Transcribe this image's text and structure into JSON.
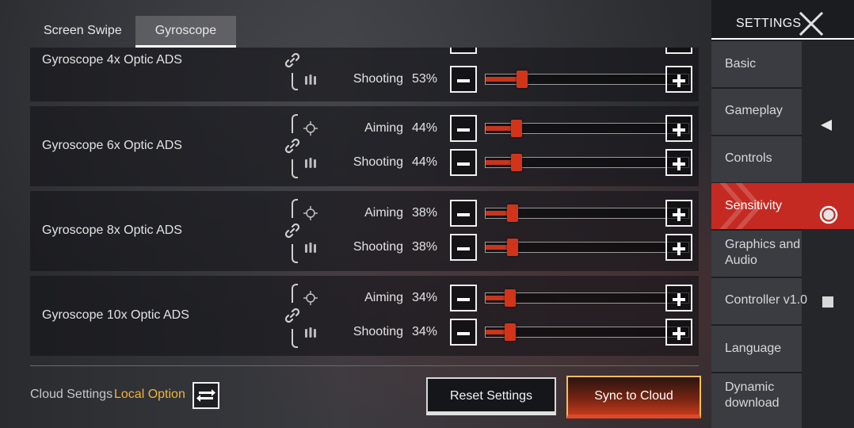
{
  "tabs": [
    {
      "label": "Screen Swipe",
      "active": false
    },
    {
      "label": "Gyroscope",
      "active": true
    }
  ],
  "groups": [
    {
      "label": "Gyroscope 4x Optic ADS",
      "rows": [
        {
          "label": "Shooting",
          "value_text": "53%",
          "value": 53
        }
      ]
    },
    {
      "label": "Gyroscope 6x Optic ADS",
      "rows": [
        {
          "label": "Aiming",
          "value_text": "44%",
          "value": 44
        },
        {
          "label": "Shooting",
          "value_text": "44%",
          "value": 44
        }
      ]
    },
    {
      "label": "Gyroscope 8x Optic ADS",
      "rows": [
        {
          "label": "Aiming",
          "value_text": "38%",
          "value": 38
        },
        {
          "label": "Shooting",
          "value_text": "38%",
          "value": 38
        }
      ]
    },
    {
      "label": "Gyroscope 10x Optic ADS",
      "rows": [
        {
          "label": "Aiming",
          "value_text": "34%",
          "value": 34
        },
        {
          "label": "Shooting",
          "value_text": "34%",
          "value": 34
        }
      ]
    }
  ],
  "bottom": {
    "cloud_label": "Cloud Settings",
    "local_label": "Local Option",
    "reset_label": "Reset Settings",
    "sync_label": "Sync to Cloud"
  },
  "sidebar": {
    "title": "SETTINGS",
    "items": [
      {
        "label": "Basic"
      },
      {
        "label": "Gameplay"
      },
      {
        "label": "Controls"
      },
      {
        "label": "Sensitivity",
        "active": true
      },
      {
        "label": "Graphics and Audio"
      },
      {
        "label": "Controller v1.0"
      },
      {
        "label": "Language"
      },
      {
        "label": "Dynamic download"
      }
    ]
  },
  "colors": {
    "accent_red": "#c42a22",
    "slider_red": "#d2341a",
    "local_option": "#f0b43a"
  },
  "icons": {
    "link": "link-icon",
    "aiming": "crosshair-icon",
    "shooting": "bullets-icon",
    "swap": "swap-icon",
    "close": "close-x-icon"
  }
}
